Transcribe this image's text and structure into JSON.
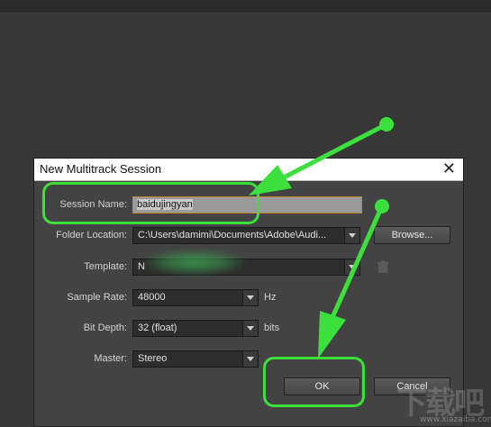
{
  "dialog": {
    "title": "New Multitrack Session",
    "close_glyph": "✕"
  },
  "form": {
    "session_name_label": "Session Name:",
    "session_name_value": "baidujingyan",
    "folder_location_label": "Folder Location:",
    "folder_location_value": "C:\\Users\\damimi\\Documents\\Adobe\\Audi...",
    "browse_button": "Browse...",
    "template_label": "Template:",
    "template_value": "N",
    "sample_rate_label": "Sample Rate:",
    "sample_rate_value": "48000",
    "sample_rate_unit": "Hz",
    "bit_depth_label": "Bit Depth:",
    "bit_depth_value": "32 (float)",
    "bit_depth_unit": "bits",
    "master_label": "Master:",
    "master_value": "Stereo",
    "ok_button": "OK",
    "cancel_button": "Cancel"
  },
  "annotations": {
    "highlight_color": "#3ce03c"
  },
  "watermark": {
    "large": "下载吧",
    "small": "www.xiazaiba.com"
  }
}
